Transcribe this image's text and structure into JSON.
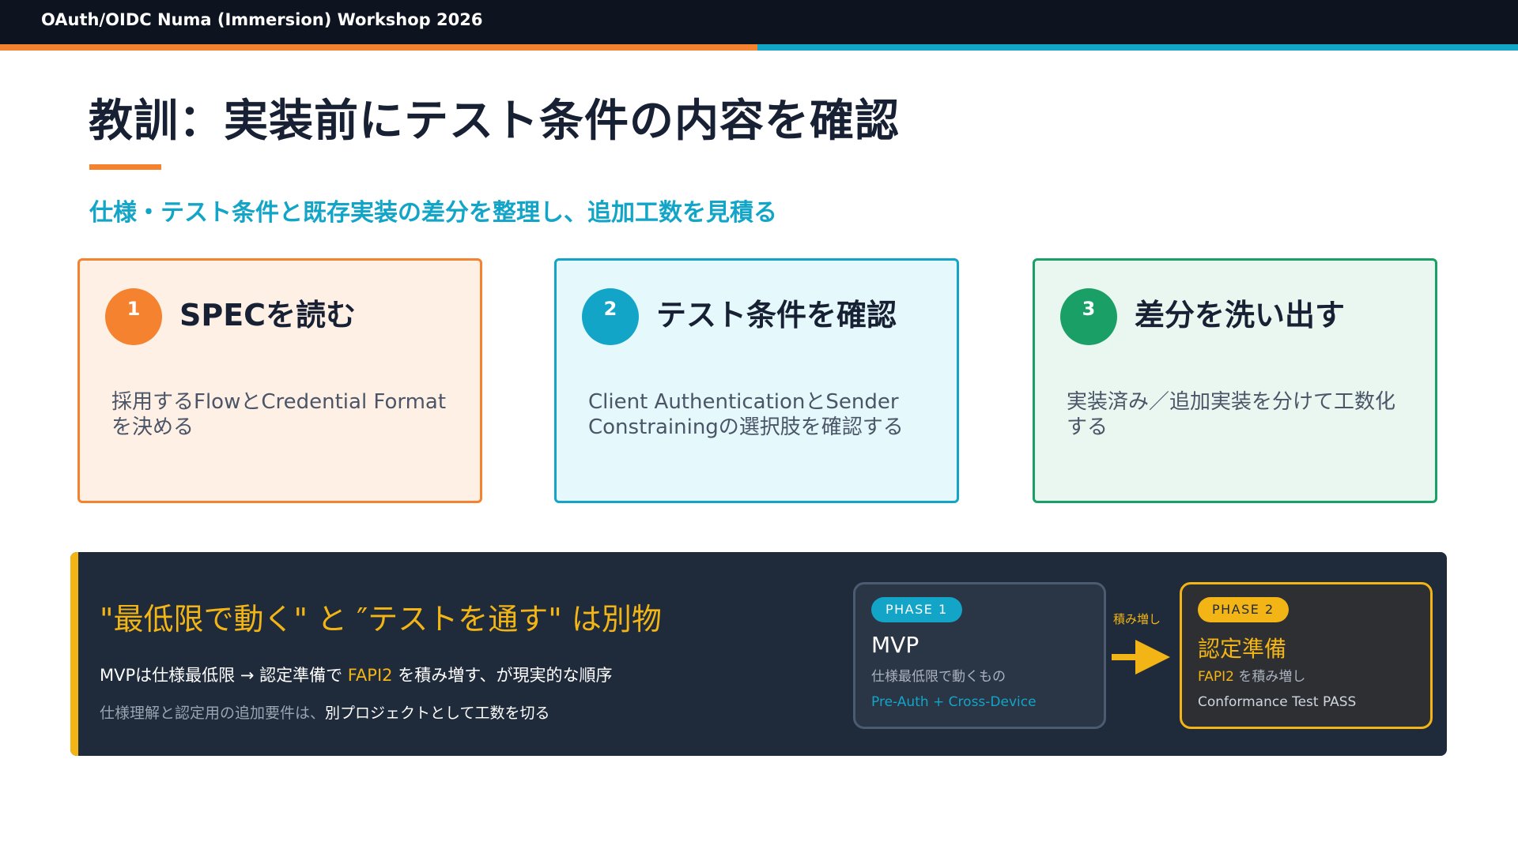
{
  "header": {
    "title": "OAuth/OIDC Numa (Immersion) Workshop 2026"
  },
  "slide": {
    "title": "教訓：実装前にテスト条件の内容を確認",
    "subtitle": "仕様・テスト条件と既存実装の差分を整理し、追加工数を見積る"
  },
  "steps": [
    {
      "number": "1",
      "heading": "SPECを読む",
      "body": "採用するFlowとCredential Formatを決める",
      "color": "#f5822f"
    },
    {
      "number": "2",
      "heading": "テスト条件を確認",
      "body": "Client AuthenticationとSender Constrainingの選択肢を確認する",
      "color": "#12a5c7"
    },
    {
      "number": "3",
      "heading": "差分を洗い出す",
      "body": "実装済み／追加実装を分けて工数化する",
      "color": "#1aa066"
    }
  ],
  "lesson": {
    "title": "\"最低限で動く\" と ″テストを通す\" は別物",
    "line1": {
      "before": "MVPは仕様最低限 → 認定準備で ",
      "highlight": "FAPI2",
      "after": " を積み増す、が現実的な順序"
    },
    "line2": {
      "before": "仕様理解と認定用の追加要件は、",
      "emphasis": "別プロジェクトとして工数を切る"
    },
    "arrow_label": "積み増し",
    "phases": [
      {
        "tag": "PHASE 1",
        "name": "MVP",
        "desc": "仕様最低限で動くもの",
        "detail": "Pre-Auth + Cross-Device"
      },
      {
        "tag": "PHASE 2",
        "name": "認定準備",
        "desc_highlight": "FAPI2",
        "desc": " を積み増し",
        "detail": "Conformance Test PASS"
      }
    ]
  },
  "colors": {
    "orange": "#f5822f",
    "cyan": "#12a5c7",
    "green": "#1aa066",
    "gold": "#f2b515",
    "navy": "#1f2a3b",
    "header": "#0d141f"
  }
}
